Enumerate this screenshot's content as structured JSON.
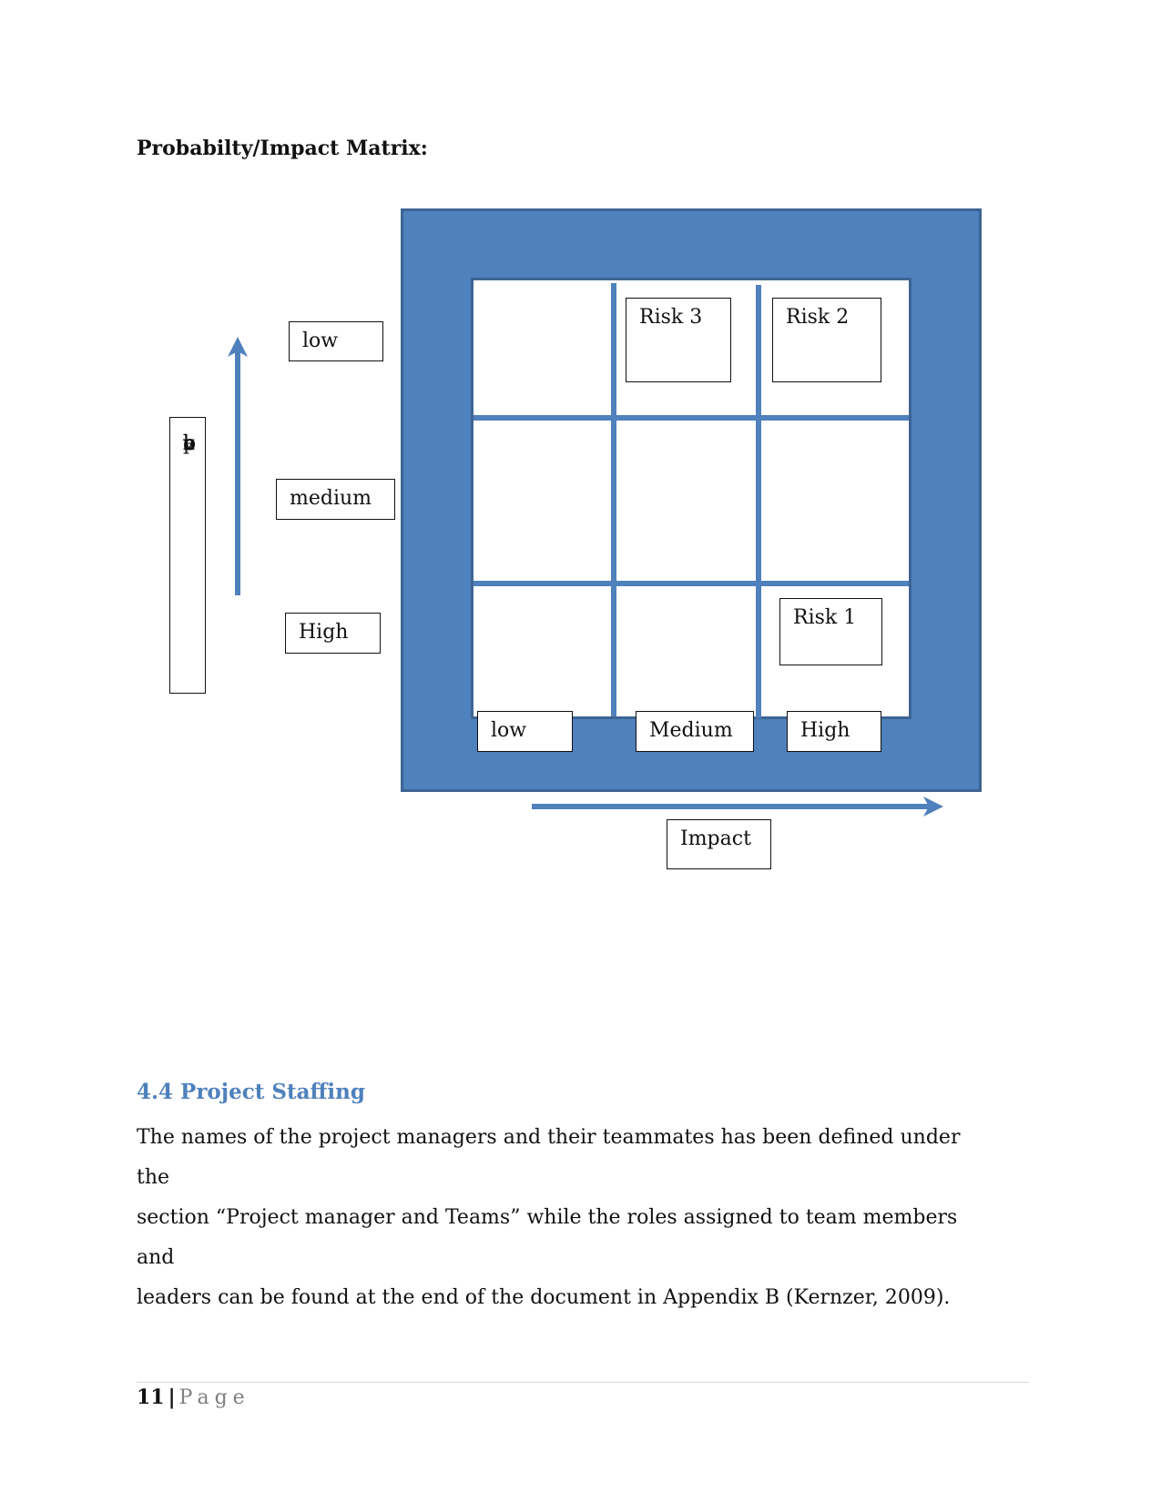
{
  "document": {
    "section_title": "Probabilty/Impact Matrix:",
    "matrix": {
      "probability_axis_label_letters": [
        "p",
        "r",
        "o",
        "b",
        "a",
        "b",
        "l",
        "i",
        "t",
        "v"
      ],
      "probability_levels": [
        "low",
        "medium",
        "High"
      ],
      "impact_levels": [
        "low",
        "Medium",
        "High"
      ],
      "impact_axis_label": "Impact",
      "risks": [
        {
          "label": "Risk 3",
          "probability": "low",
          "impact": "Medium"
        },
        {
          "label": "Risk 2",
          "probability": "low",
          "impact": "High"
        },
        {
          "label": "Risk 1",
          "probability": "High",
          "impact": "High"
        }
      ],
      "colors": {
        "frame": "#4f81bd",
        "frame_border": "#3d6594"
      }
    },
    "staffing": {
      "heading": "4.4 Project Staffing",
      "paragraph_lines": [
        "The names of the project managers and their teammates has been defined under the",
        "section “Project manager and Teams” while the roles assigned to team members and",
        "leaders can be found at the end of the document in Appendix B (Kernzer, 2009)."
      ],
      "heading_color": "#4f81bd"
    },
    "footer": {
      "page_number": "11",
      "separator": "|",
      "page_word": "Page"
    }
  }
}
